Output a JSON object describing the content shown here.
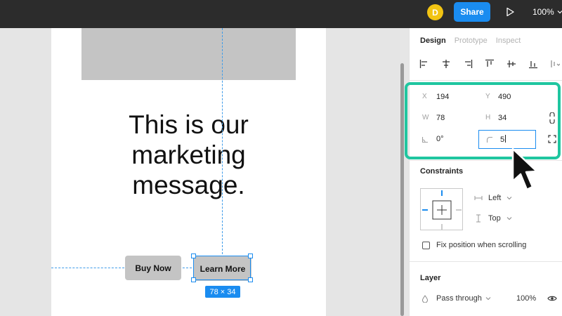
{
  "topbar": {
    "avatar_initial": "D",
    "share_label": "Share",
    "zoom_level": "100%",
    "icons": [
      "play-icon",
      "chevron-down-icon"
    ]
  },
  "canvas": {
    "headline": "This is our\nmarketing\nmessage.",
    "buy_button_label": "Buy Now",
    "learn_button_label": "Learn More",
    "selection_dimensions": "78 × 34"
  },
  "panel": {
    "tabs": [
      {
        "label": "Design",
        "active": true
      },
      {
        "label": "Prototype",
        "active": false
      },
      {
        "label": "Inspect",
        "active": false
      }
    ],
    "properties": {
      "x_label": "X",
      "x_value": "194",
      "y_label": "Y",
      "y_value": "490",
      "w_label": "W",
      "w_value": "78",
      "h_label": "H",
      "h_value": "34",
      "rotation": "0°",
      "corner_radius": "5"
    },
    "constraints": {
      "title": "Constraints",
      "horizontal": "Left",
      "vertical": "Top"
    },
    "fix_position_label": "Fix position when scrolling",
    "layer": {
      "title": "Layer",
      "blend_mode": "Pass through",
      "opacity": "100%"
    }
  },
  "colors": {
    "accent": "#1a8cf0",
    "highlight": "#1fc6a0",
    "avatar": "#f2c413",
    "toolbar": "#2c2c2c"
  }
}
